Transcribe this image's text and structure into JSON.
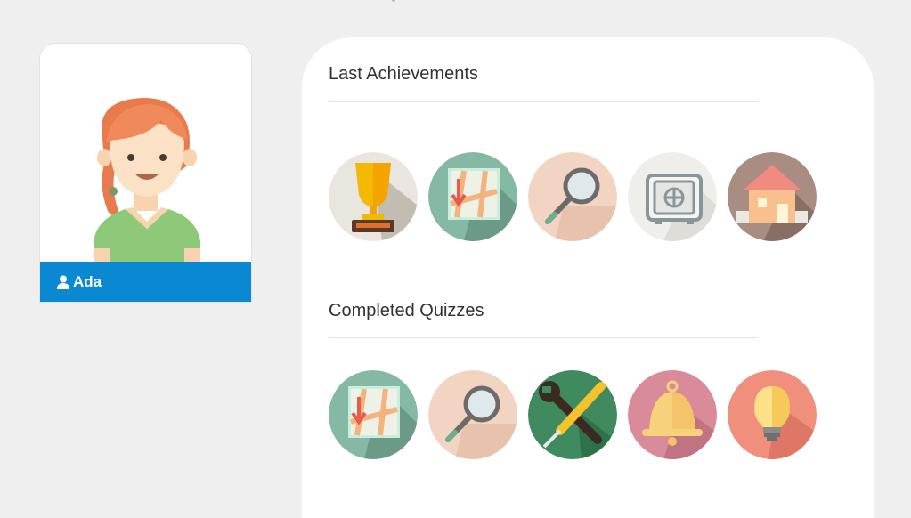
{
  "profile": {
    "name": "Ada",
    "avatar_icon": "girl-avatar-icon",
    "user_icon": "user-icon",
    "accent_color": "#0a88d1"
  },
  "sections": {
    "achievements": {
      "title": "Last Achievements",
      "badges": [
        "trophy-icon",
        "map-icon",
        "magnifier-icon",
        "safe-icon",
        "house-icon"
      ]
    },
    "quizzes": {
      "title": "Completed Quizzes",
      "badges": [
        "map-icon",
        "magnifier-icon",
        "tools-icon",
        "bell-icon",
        "lightbulb-icon"
      ]
    }
  }
}
